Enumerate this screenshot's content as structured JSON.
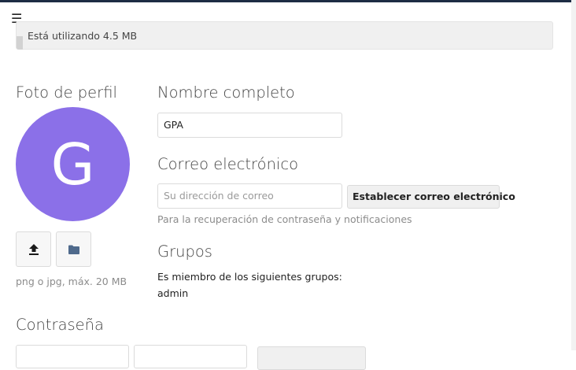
{
  "header": {
    "menu_icon": "hamburger-menu-icon"
  },
  "quota": {
    "text": "Está utilizando 4.5 MB",
    "usage_fraction": 0.01
  },
  "profile_photo": {
    "heading": "Foto de perfil",
    "avatar_letter": "G",
    "avatar_color": "#8b70e8",
    "upload_icon": "upload-icon",
    "choose_file_icon": "folder-icon",
    "hint": "png o jpg, máx. 20 MB"
  },
  "full_name": {
    "heading": "Nombre completo",
    "value": "GPA"
  },
  "email": {
    "heading": "Correo electrónico",
    "placeholder": "Su dirección de correo",
    "set_button_label": "Establecer correo electrónico",
    "hint": "Para la recuperación de contraseña y notificaciones"
  },
  "groups": {
    "heading": "Grupos",
    "description": "Es miembro de los siguientes grupos:",
    "list": [
      "admin"
    ]
  },
  "password": {
    "heading": "Contraseña"
  }
}
